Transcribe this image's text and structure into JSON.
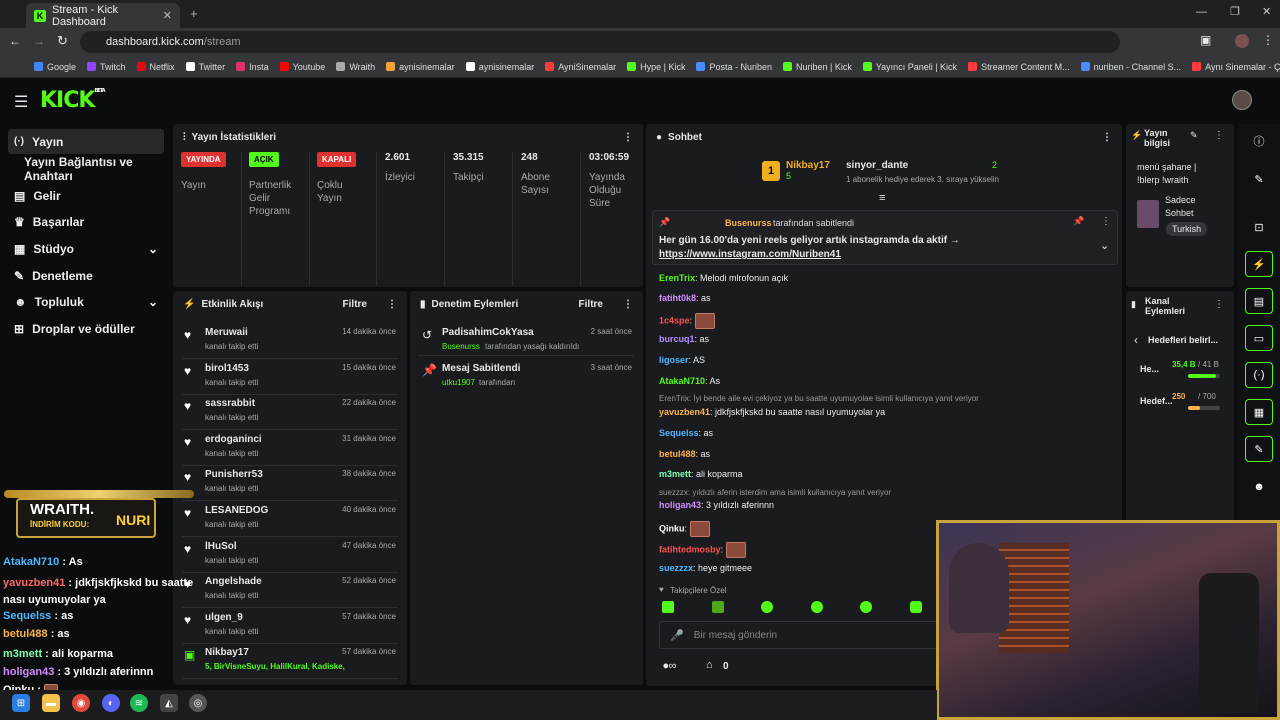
{
  "browser": {
    "tab_title": "Stream - Kick Dashboard",
    "url_host": "dashboard.kick.com",
    "url_path": "/stream"
  },
  "bookmarks": [
    "Google",
    "Twitch",
    "Netflix",
    "Twitter",
    "Insta",
    "Youtube",
    "Wraith",
    "aynisinemalar",
    "aynisinemalar",
    "AyniSinemalar",
    "Hype | Kick",
    "Posta - Nuriben",
    "Nuriben | Kick",
    "Yayıncı Paneli | Kick",
    "Streamer Content M...",
    "nuriben - Channel S...",
    "Aynı Sinemalar - Ça..."
  ],
  "brand": {
    "logo": "KICK",
    "beta": "BETA",
    "accent": "#53fc18"
  },
  "sidebar": {
    "items": [
      "Yayın",
      "Yayın Bağlantısı ve Anahtarı",
      "Gelir",
      "Başarılar",
      "Stüdyo",
      "Denetleme",
      "Topluluk",
      "Droplar ve ödüller"
    ]
  },
  "stats": {
    "title": "Yayın İstatistikleri",
    "badges": [
      {
        "label": "YAYINDA",
        "sub": "Yayın"
      },
      {
        "label": "AÇIK",
        "sub": "Partnerlik Gelir Programı"
      },
      {
        "label": "KAPALI",
        "sub": "Çoklu Yayın"
      }
    ],
    "values": [
      {
        "v": "2.601",
        "l": "İzleyici"
      },
      {
        "v": "35.315",
        "l": "Takipçi"
      },
      {
        "v": "248",
        "l": "Abone Sayısı"
      },
      {
        "v": "03:06:59",
        "l": "Yayında Olduğu Süre"
      }
    ]
  },
  "activity": {
    "title": "Etkinlik Akışı",
    "filter": "Filtre",
    "items": [
      {
        "name": "Meruwaii",
        "sub": "kanalı takip etti",
        "time": "14 dakika önce"
      },
      {
        "name": "birol1453",
        "sub": "kanalı takip etti",
        "time": "15 dakika önce"
      },
      {
        "name": "sassrabbit",
        "sub": "kanalı takip etti",
        "time": "22 dakika önce"
      },
      {
        "name": "erdoganinci",
        "sub": "kanalı takip etti",
        "time": "31 dakika önce"
      },
      {
        "name": "Punisherr53",
        "sub": "kanalı takip etti",
        "time": "38 dakika önce"
      },
      {
        "name": "LESANEDOG",
        "sub": "kanalı takip etti",
        "time": "40 dakika önce"
      },
      {
        "name": "lHuSol",
        "sub": "kanalı takip etti",
        "time": "47 dakika önce"
      },
      {
        "name": "Angelshade",
        "sub": "kanalı takip etti",
        "time": "52 dakika önce"
      },
      {
        "name": "ulgen_9",
        "sub": "kanalı takip etti",
        "time": "57 dakika önce"
      },
      {
        "name": "Nikbay17",
        "sub": "5, BirVisneSuyu, HalilKural, Kadiske,",
        "time": "57 dakika önce"
      }
    ]
  },
  "moderation": {
    "title": "Denetim Eylemleri",
    "filter": "Filtre",
    "items": [
      {
        "name": "PadisahimCokYasa",
        "user": "Busenurss",
        "action": "tarafından yasağı kaldırıldı",
        "time": "2 saat önce"
      },
      {
        "name": "Mesaj Sabitlendi",
        "user": "utku1907",
        "action": "tarafından",
        "time": "3 saat önce"
      }
    ]
  },
  "chat": {
    "title": "Sohbet",
    "top": {
      "user1": "Nikbay17",
      "count1": "5",
      "user2": "sinyor_dante",
      "count2": "2",
      "note": "1 abonelik hediye ederek 3. sıraya yükselin"
    },
    "pinned": {
      "by": "Busenurss",
      "by_text": "tarafından sabitlendi",
      "text": "Her gün 16.00'da yeni reels geliyor artık instagramda da aktif →",
      "link": "https://www.instagram.com/Nuriben41"
    },
    "messages": [
      {
        "u": "ErenTrix",
        "c": "#53fc18",
        "t": "Melodi mlrofonun açık"
      },
      {
        "u": "fatiht0k8",
        "c": "#d58bff",
        "t": "as"
      },
      {
        "u": "1c4spe",
        "c": "#ff4f4f",
        "t": ""
      },
      {
        "u": "burcuq1",
        "c": "#b98cff",
        "t": "as"
      },
      {
        "u": "ligoser",
        "c": "#4fb7ff",
        "t": "AS"
      },
      {
        "u": "AtakaN710",
        "c": "#53fc18",
        "t": "As"
      },
      {
        "u": "yavuzben41",
        "c": "#ffb347",
        "t": "jdkfjskfjkskd bu saatte nasıl uyumuyolar ya",
        "reply": "ErenTrix: İyi bende aile evi çekiyoz ya bu saatte uyumuyolae isimli kullanıcıya yanıt veriyor"
      },
      {
        "u": "Sequelss",
        "c": "#4fb7ff",
        "t": "as"
      },
      {
        "u": "betul488",
        "c": "#ffb347",
        "t": "as"
      },
      {
        "u": "m3mett",
        "c": "#7dffb0",
        "t": "ali koparma"
      },
      {
        "u": "holigan43",
        "c": "#d58bff",
        "t": "3 yıldızlı aferinnn",
        "reply": "suezzzx: yıldızlı aferin isterdim ama isimli kullanıcıya yanıt veriyor"
      },
      {
        "u": "Qinku",
        "c": "#ffffff",
        "t": ""
      },
      {
        "u": "fatihtedmosby",
        "c": "#ff4f4f",
        "t": ""
      },
      {
        "u": "suezzzx",
        "c": "#4fb7ff",
        "t": "heye gitmeee"
      }
    ],
    "followers_only": "Takipçilere Özel",
    "placeholder": "Bir mesaj gönderin",
    "cost": "0"
  },
  "info": {
    "title": "Yayın bilgisi",
    "text": "menü şahane | !blerp !wraith",
    "mode": "Sadece Sohbet",
    "lang": "Turkish"
  },
  "channel_actions": {
    "title": "Kanal Eylemleri",
    "goals_title": "Hedefleri belirl...",
    "goals": [
      {
        "label": "He...",
        "value": "35,4 B",
        "max": "/ 41 B",
        "fill": 0.86,
        "color": "#53fc18"
      },
      {
        "label": "Hedef...",
        "value": "250",
        "max": "/ 700",
        "fill": 0.36,
        "color": "#ffb347"
      }
    ]
  },
  "overlay": {
    "brand": "WRAITH.",
    "code_label": "İNDİRİM KODU:",
    "code": "NURI",
    "chat": [
      {
        "u": "AtakaN710",
        "c": "#4fb7ff",
        "t": "As"
      },
      {
        "u": "yavuzben41",
        "c": "#ff6a6a",
        "t": "jdkfjskfjkskd bu saatte nası uyumuyolar ya"
      },
      {
        "u": "Sequelss",
        "c": "#4fb7ff",
        "t": "as"
      },
      {
        "u": "betul488",
        "c": "#ffb347",
        "t": "as"
      },
      {
        "u": "m3mett",
        "c": "#7dffb0",
        "t": "ali koparma"
      },
      {
        "u": "holigan43",
        "c": "#d58bff",
        "t": "3 yıldızlı aferinnn"
      },
      {
        "u": "Qinku",
        "c": "#ffffff",
        "t": ""
      }
    ]
  }
}
